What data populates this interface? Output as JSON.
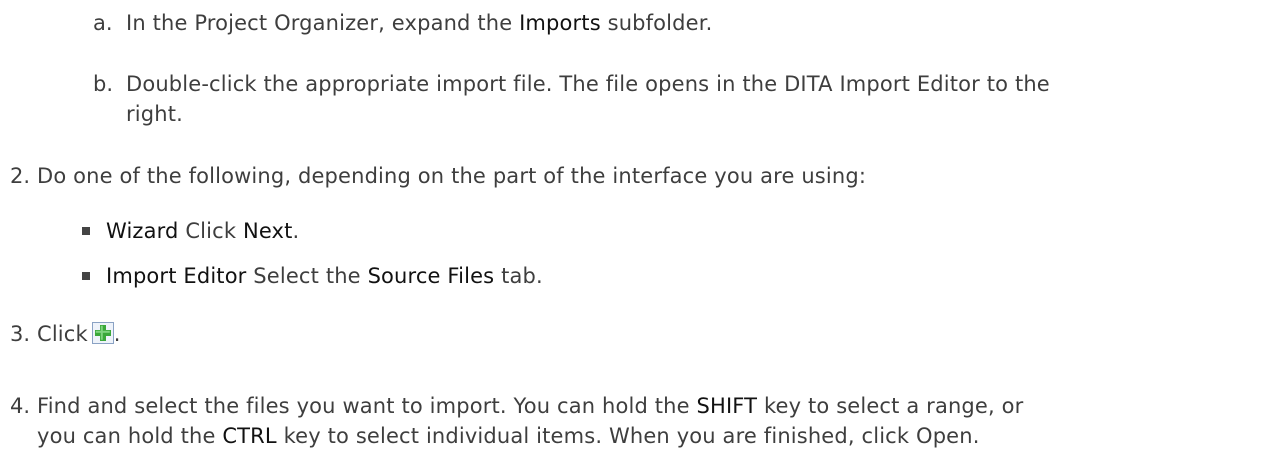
{
  "sub_steps": [
    {
      "marker": "a.",
      "text_before": "In the Project Organizer, expand the ",
      "bold": "Imports",
      "text_after": " subfolder."
    },
    {
      "marker": "b.",
      "line1": "Double-click the appropriate import file. The file opens in the DITA Import Editor to the",
      "line2": "right."
    }
  ],
  "steps": [
    {
      "marker": "2.",
      "text": "Do one of the following, depending on the part of the interface you are using:",
      "options": [
        {
          "label": "Wizard",
          "text_before": " Click ",
          "bold": "Next",
          "text_after": "."
        },
        {
          "label": "Import Editor",
          "text_before": " Select the ",
          "bold": "Source Files",
          "text_after": " tab."
        }
      ]
    },
    {
      "marker": "3.",
      "text_before": "Click",
      "icon": "green-plus-add-icon",
      "text_after": "."
    },
    {
      "marker": "4.",
      "line1_part1": "Find and select the files you want to import. You can hold the ",
      "line1_bold": "SHIFT",
      "line1_part2": " key to select a range, or",
      "line2_part1": "you can hold the ",
      "line2_bold": "CTRL",
      "line2_part2": " key to select individual items. When you are finished, click Open."
    }
  ],
  "colors": {
    "text": "#3e3e3e",
    "emphasis": "#111111",
    "icon_green": "#3aa83a",
    "icon_border": "#8aa2c4"
  }
}
